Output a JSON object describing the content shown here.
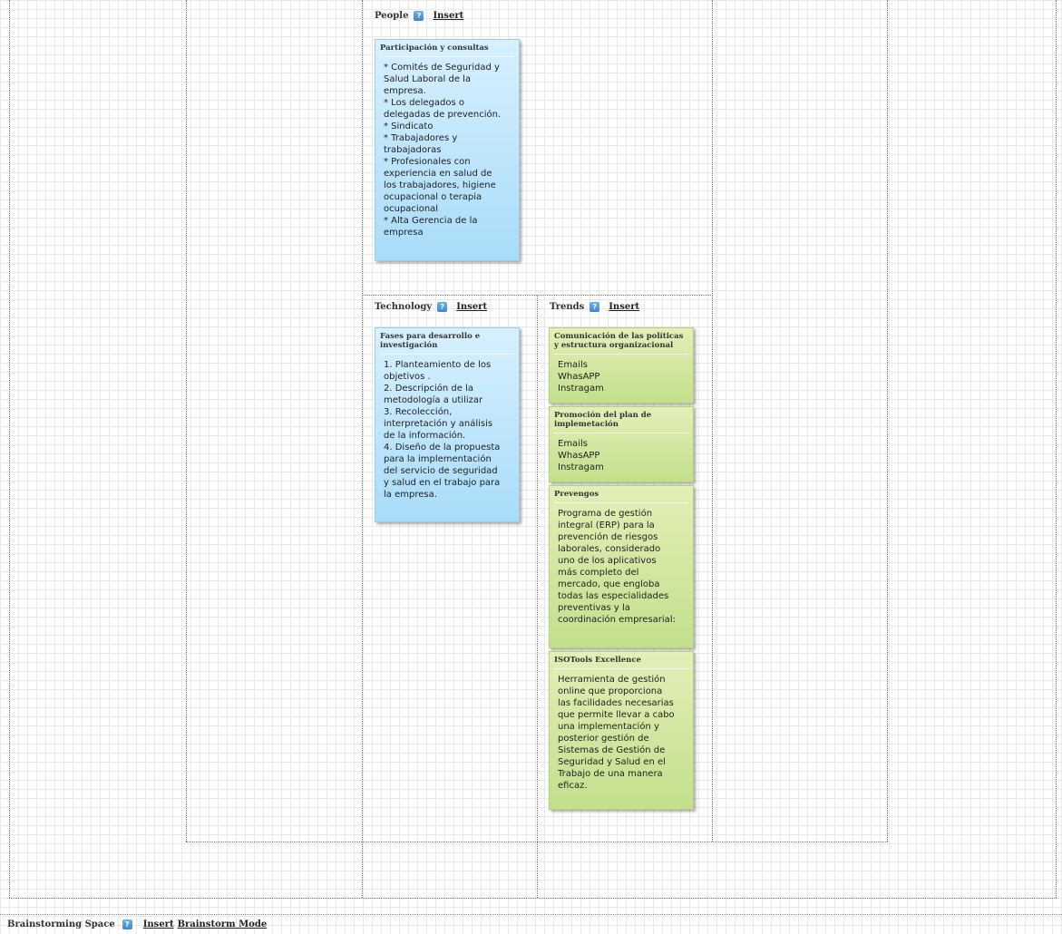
{
  "sections": {
    "people": {
      "title": "People",
      "insert_label": "Insert"
    },
    "technology": {
      "title": "Technology",
      "insert_label": "Insert"
    },
    "trends": {
      "title": "Trends",
      "insert_label": "Insert"
    }
  },
  "help_icon": {
    "glyph": "?"
  },
  "notes": {
    "people": [
      {
        "title": "Participación y consultas",
        "body": "* Comités de Seguridad y\nSalud Laboral de la\nempresa.\n* Los delegados o\ndelegadas de prevención.\n* Sindicato\n* Trabajadores y\ntrabajadoras\n* Profesionales con\nexperiencia en salud de\nlos trabajadores, higiene\nocupacional o terapia\nocupacional\n* Alta Gerencia de la\nempresa"
      }
    ],
    "technology": [
      {
        "title": "Fases para desarrollo e\ninvestigación",
        "body": "1. Planteamiento de los\nobjetivos .\n2. Descripción de la\nmetodología a utilizar\n3. Recolección,\ninterpretación y análisis\nde la información.\n4. Diseño de la propuesta\npara la implementación\ndel servicio de seguridad\ny salud en el trabajo para\nla empresa."
      }
    ],
    "trends": [
      {
        "title": "Comunicación de las políticas\ny estructura organizacional",
        "body": "Emails\nWhasAPP\nInstragam"
      },
      {
        "title": "Promoción del plan de\nimplemetación",
        "body": "Emails\nWhasAPP\nInstragam"
      },
      {
        "title": "Prevengos",
        "body": "Programa de gestión\nintegral (ERP) para la\nprevención de riesgos\nlaborales, considerado\nuno de los aplicativos\nmás completo del\nmercado, que engloba\ntodas las especialidades\npreventivas y la\ncoordinación empresarial:"
      },
      {
        "title": "ISOTools Excellence",
        "body": "Herramienta de gestión\nonline que proporciona\nlas facilidades necesarias\nque permite llevar a cabo\nuna implementación y\nposterior gestión de\nSistemas de Gestión de\nSeguridad y Salud en el\nTrabajo de una manera\neficaz."
      }
    ]
  },
  "bottom_bar": {
    "title": "Brainstorming Space",
    "insert_label": "Insert",
    "mode_label": "Brainstorm Mode"
  },
  "colors": {
    "note_blue": "#b9e4fc",
    "note_green": "#cfe59e",
    "help_icon": "#3a86d0"
  }
}
